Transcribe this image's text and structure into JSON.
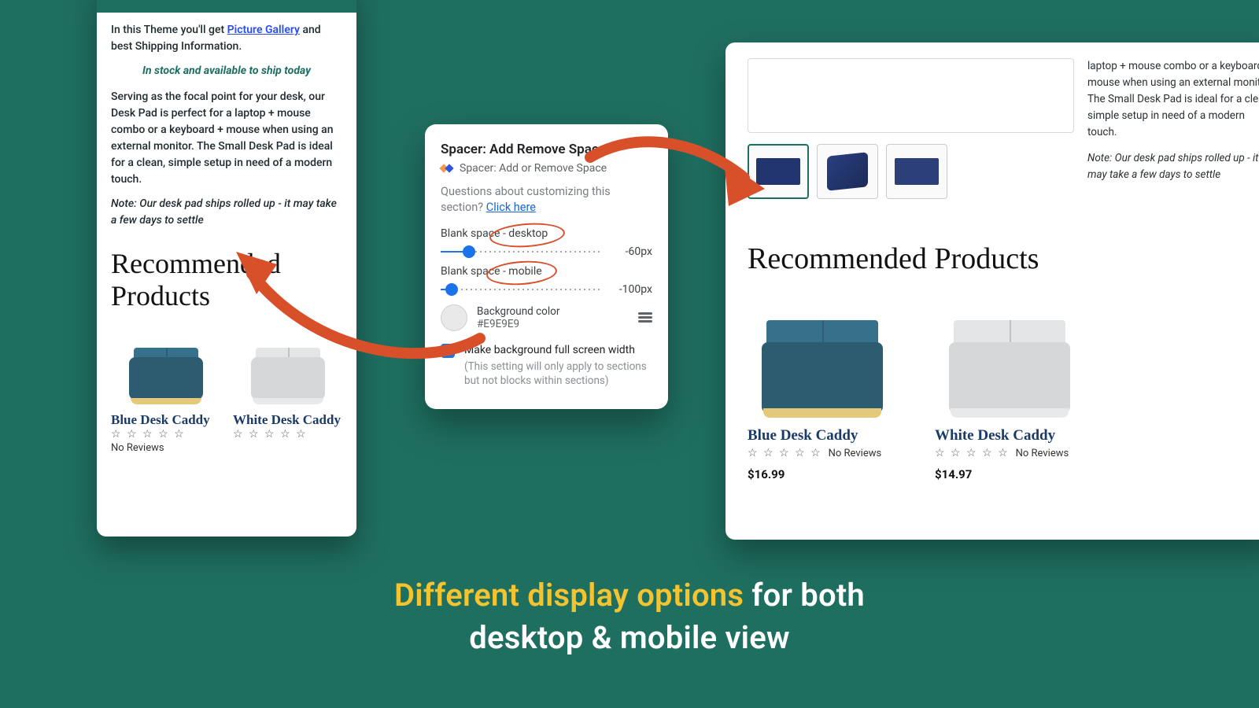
{
  "mobile": {
    "intro_pre": "In this Theme you'll get ",
    "intro_link": "Picture Gallery",
    "intro_post": " and best Shipping Information.",
    "stock": "In stock and available to ship today",
    "desc": "Serving as the focal point for your desk, our Desk Pad is perfect for a laptop + mouse combo or a keyboard + mouse when using an external monitor. The Small Desk Pad is ideal for a clean, simple setup in need of a modern touch.",
    "note": "Note: Our desk pad ships rolled up - it may take a few days to settle",
    "rec_heading": "Recommended Products",
    "p1_name": "Blue Desk Caddy",
    "p1_rev": "No Reviews",
    "p2_name": "White Desk Caddy"
  },
  "popover": {
    "title": "Spacer: Add Remove Space",
    "subtitle": "Spacer: Add or Remove Space",
    "q_pre": "Questions about customizing this section? ",
    "q_link": "Click here",
    "lbl_desktop": "Blank space - desktop",
    "val_desktop": "-60px",
    "lbl_mobile": "Blank space - mobile",
    "val_mobile": "-100px",
    "bg_label": "Background color",
    "bg_hex": "#E9E9E9",
    "ck_label": "Make background full screen width",
    "ck_sub": "(This setting will only apply to sections but not blocks within sections)"
  },
  "desktop": {
    "side_desc": "laptop + mouse combo or a keyboard + mouse when using an external monitor. The Small Desk Pad is ideal for a clean, simple setup in need of a modern touch.",
    "side_note": "Note: Our desk pad ships rolled up - it may take a few days to settle",
    "rec_heading": "Recommended Products",
    "p1_name": "Blue Desk Caddy",
    "p1_rev": "No Reviews",
    "p1_price": "$16.99",
    "p2_name": "White Desk Caddy",
    "p2_rev": "No Reviews",
    "p2_price": "$14.97"
  },
  "tagline": {
    "hl": "Different display options",
    "l1": " for both",
    "l2": "desktop & mobile view"
  }
}
